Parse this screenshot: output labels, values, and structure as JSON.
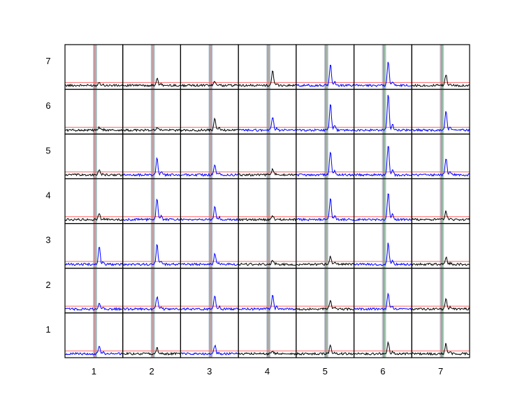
{
  "chart_data": {
    "type": "line",
    "title": "",
    "xlabel": "",
    "ylabel": "",
    "x_tick_labels": [
      "1",
      "2",
      "3",
      "4",
      "5",
      "6",
      "7"
    ],
    "y_tick_labels": [
      "7",
      "6",
      "5",
      "4",
      "3",
      "2",
      "1"
    ],
    "grid": "7x7 panel matrix",
    "colors": {
      "significant": "#0000ff",
      "not_significant": "#000000",
      "threshold": "#ff6666",
      "marker_band": "#8aa0b8",
      "marker_red": "#cc6666",
      "marker_green": "#77aa77"
    },
    "panels_row_1_to_7": {
      "row7": [
        {
          "peak": 0.1,
          "sig": false
        },
        {
          "peak": 0.18,
          "sig": false
        },
        {
          "peak": 0.12,
          "sig": false
        },
        {
          "peak": 0.38,
          "sig": false
        },
        {
          "peak": 0.55,
          "sig": true
        },
        {
          "peak": 0.62,
          "sig": true
        },
        {
          "peak": 0.28,
          "sig": false
        }
      ],
      "row6": [
        {
          "peak": 0.06,
          "sig": false
        },
        {
          "peak": 0.08,
          "sig": false
        },
        {
          "peak": 0.3,
          "sig": false
        },
        {
          "peak": 0.35,
          "sig": true
        },
        {
          "peak": 0.68,
          "sig": true
        },
        {
          "peak": 0.95,
          "sig": true
        },
        {
          "peak": 0.48,
          "sig": true
        }
      ],
      "row5": [
        {
          "peak": 0.12,
          "sig": false
        },
        {
          "peak": 0.42,
          "sig": true
        },
        {
          "peak": 0.25,
          "sig": true
        },
        {
          "peak": 0.14,
          "sig": false
        },
        {
          "peak": 0.62,
          "sig": true
        },
        {
          "peak": 0.78,
          "sig": true
        },
        {
          "peak": 0.45,
          "sig": true
        }
      ],
      "row4": [
        {
          "peak": 0.15,
          "sig": false
        },
        {
          "peak": 0.55,
          "sig": true
        },
        {
          "peak": 0.35,
          "sig": true
        },
        {
          "peak": 0.1,
          "sig": false
        },
        {
          "peak": 0.55,
          "sig": true
        },
        {
          "peak": 0.7,
          "sig": true
        },
        {
          "peak": 0.22,
          "sig": false
        }
      ],
      "row3": [
        {
          "peak": 0.45,
          "sig": true
        },
        {
          "peak": 0.52,
          "sig": true
        },
        {
          "peak": 0.28,
          "sig": true
        },
        {
          "peak": 0.1,
          "sig": false
        },
        {
          "peak": 0.2,
          "sig": false
        },
        {
          "peak": 0.55,
          "sig": true
        },
        {
          "peak": 0.18,
          "sig": false
        }
      ],
      "row2": [
        {
          "peak": 0.18,
          "sig": true
        },
        {
          "peak": 0.32,
          "sig": true
        },
        {
          "peak": 0.35,
          "sig": true
        },
        {
          "peak": 0.35,
          "sig": true
        },
        {
          "peak": 0.22,
          "sig": false
        },
        {
          "peak": 0.42,
          "sig": true
        },
        {
          "peak": 0.25,
          "sig": false
        }
      ],
      "row1": [
        {
          "peak": 0.22,
          "sig": true
        },
        {
          "peak": 0.16,
          "sig": false
        },
        {
          "peak": 0.22,
          "sig": true
        },
        {
          "peak": 0.08,
          "sig": false
        },
        {
          "peak": 0.22,
          "sig": false
        },
        {
          "peak": 0.28,
          "sig": false
        },
        {
          "peak": 0.26,
          "sig": false
        }
      ]
    }
  }
}
